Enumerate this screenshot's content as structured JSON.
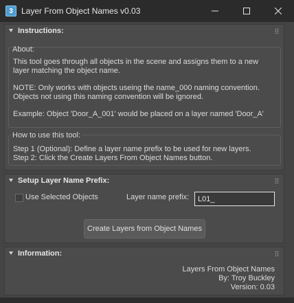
{
  "window": {
    "title": "Layer From Object Names v0.03",
    "app_icon_glyph": "3",
    "controls": [
      "minimize-icon",
      "maximize-icon",
      "close-icon"
    ]
  },
  "instructions": {
    "title": "Instructions:",
    "about": {
      "label": "About:",
      "line1": "This tool goes through all objects in the scene and assigns them to a new",
      "line2": "layer matching the object name.",
      "line3": "NOTE: Only works with objects useing the name_000 naming convention.",
      "line4": "Objects not using this naming convention will be ignored.",
      "line5": "Example: Object 'Door_A_001' would be placed on a layer named 'Door_A'"
    },
    "howto": {
      "label": "How to use this tool:",
      "step1": "Step 1 (Optional): Define a layer name prefix to be used for new layers.",
      "step2": "Step 2: Click the Create Layers From Object Names button."
    }
  },
  "setup": {
    "title": "Setup Layer Name Prefix:",
    "use_selected_label": "Use Selected Objects",
    "use_selected_checked": false,
    "prefix_label": "Layer name prefix:",
    "prefix_value": "L01_",
    "create_button": "Create Layers from Object Names"
  },
  "information": {
    "title": "Information:",
    "line1": "Layers From Object Names",
    "line2": "By: Troy Buckley",
    "line3": "Version: 0.03"
  }
}
